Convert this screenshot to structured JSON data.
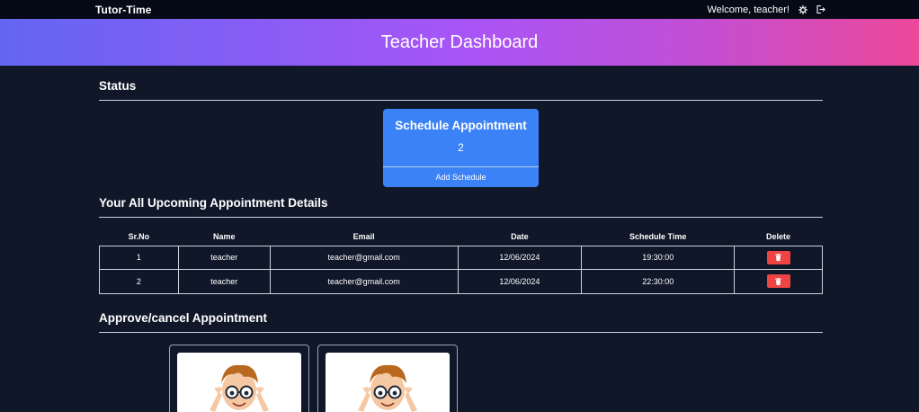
{
  "navbar": {
    "brand": "Tutor-Time",
    "welcome": "Welcome, teacher!",
    "icons": [
      "settings-icon",
      "logout-icon"
    ]
  },
  "hero": {
    "title": "Teacher Dashboard"
  },
  "status": {
    "heading": "Status",
    "card": {
      "title": "Schedule Appointment",
      "count": "2",
      "link": "Add Schedule"
    }
  },
  "upcoming": {
    "heading": "Your All Upcoming Appointment Details",
    "columns": [
      "Sr.No",
      "Name",
      "Email",
      "Date",
      "Schedule Time",
      "Delete"
    ],
    "rows": [
      [
        "1",
        "teacher",
        "teacher@gmail.com",
        "12/06/2024",
        "19:30:00"
      ],
      [
        "2",
        "teacher",
        "teacher@gmail.com",
        "12/06/2024",
        "22:30:00"
      ]
    ]
  },
  "approve": {
    "heading": "Approve/cancel Appointment",
    "cards": [
      {
        "image": "student-avatar-illustration"
      },
      {
        "image": "student-avatar-illustration"
      }
    ]
  },
  "colors": {
    "background": "#0f1729",
    "navbar": "#060a17",
    "hero_gradient": [
      "#6366f1",
      "#a855f7",
      "#ec4899"
    ],
    "card": "#3b82f6",
    "delete": "#ef4444"
  }
}
